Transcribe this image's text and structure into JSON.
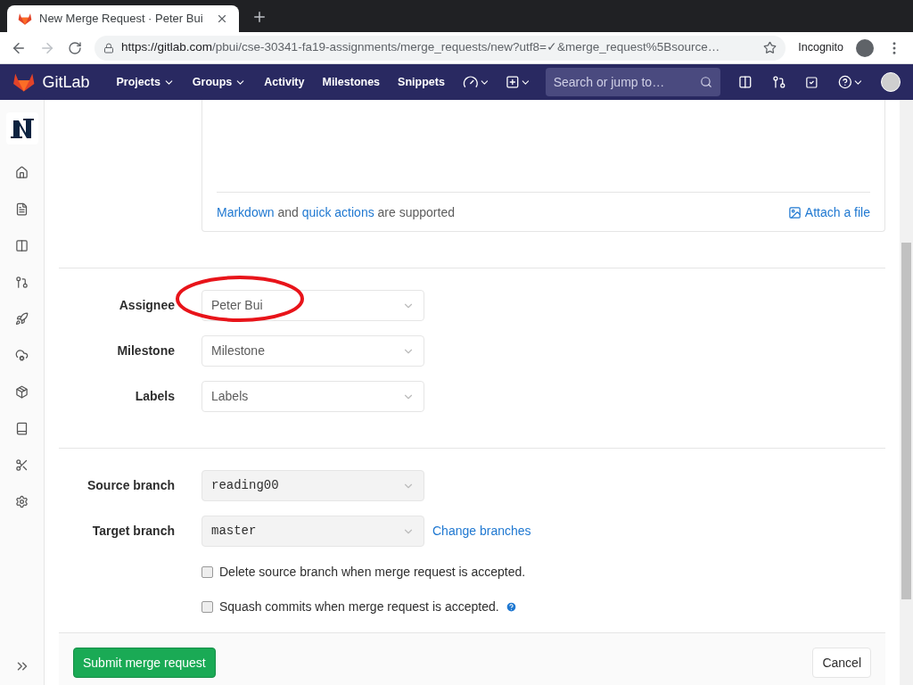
{
  "browser": {
    "tab_title": "New Merge Request · Peter Bui",
    "url_host": "https://gitlab.com",
    "url_path": "/pbui/cse-30341-fa19-assignments/merge_requests/new?utf8=✓&merge_request%5Bsource…",
    "incognito": "Incognito"
  },
  "navbar": {
    "brand": "GitLab",
    "items": [
      {
        "label": "Projects",
        "dropdown": true
      },
      {
        "label": "Groups",
        "dropdown": true
      },
      {
        "label": "Activity",
        "dropdown": false
      },
      {
        "label": "Milestones",
        "dropdown": false
      },
      {
        "label": "Snippets",
        "dropdown": false
      }
    ],
    "search": {
      "placeholder": "Search or jump to…"
    }
  },
  "sidebar": {
    "items": [
      {
        "kind": "home"
      },
      {
        "kind": "file"
      },
      {
        "kind": "issues"
      },
      {
        "kind": "merge"
      },
      {
        "kind": "rocket"
      },
      {
        "kind": "cloud"
      },
      {
        "kind": "package"
      },
      {
        "kind": "book"
      },
      {
        "kind": "scissors"
      },
      {
        "kind": "gear"
      }
    ]
  },
  "editor": {
    "hint_parts": [
      {
        "text": "Markdown",
        "link": true
      },
      {
        "text": " and ",
        "link": false
      },
      {
        "text": "quick actions",
        "link": true
      },
      {
        "text": " are supported",
        "link": false
      }
    ],
    "attach": "Attach a file"
  },
  "fields": [
    {
      "label": "Assignee",
      "value": "Peter Bui",
      "highlighted": true
    },
    {
      "label": "Milestone",
      "value": "Milestone",
      "highlighted": false
    },
    {
      "label": "Labels",
      "value": "Labels",
      "highlighted": false
    }
  ],
  "branches": [
    {
      "label": "Source branch",
      "value": "reading00"
    },
    {
      "label": "Target branch",
      "value": "master",
      "link": "Change branches"
    }
  ],
  "options": [
    {
      "label": "Delete source branch when merge request is accepted.",
      "checked": false,
      "help": false
    },
    {
      "label": "Squash commits when merge request is accepted.",
      "checked": false,
      "help": true
    }
  ],
  "actions": {
    "submit": "Submit merge request",
    "cancel": "Cancel"
  }
}
